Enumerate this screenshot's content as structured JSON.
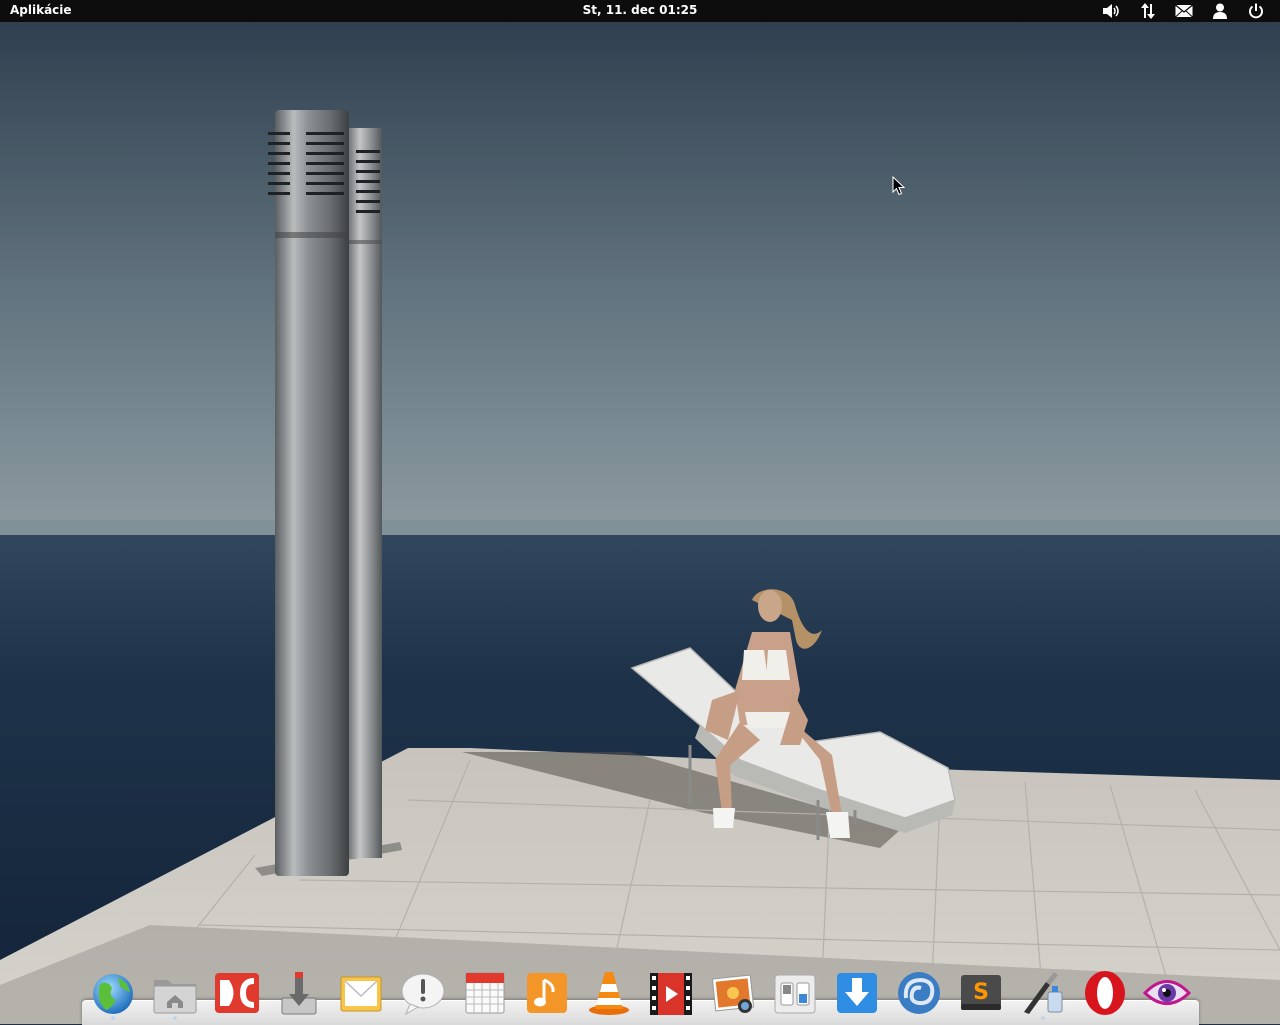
{
  "panel": {
    "applications_label": "Aplikácie",
    "clock": "St, 11. dec 01:25",
    "indicators": [
      {
        "name": "sound",
        "icon": "speaker-icon"
      },
      {
        "name": "network",
        "icon": "network-arrows-icon"
      },
      {
        "name": "messages",
        "icon": "envelope-icon"
      },
      {
        "name": "user",
        "icon": "user-icon"
      },
      {
        "name": "session",
        "icon": "power-icon"
      }
    ]
  },
  "dock": {
    "items": [
      {
        "app": "web-browser",
        "icon": "globe-icon",
        "running": true
      },
      {
        "app": "files",
        "icon": "home-folder-icon",
        "running": true
      },
      {
        "app": "double-commander",
        "icon": "dc-icon",
        "running": false
      },
      {
        "app": "software-installer",
        "icon": "install-icon",
        "running": false
      },
      {
        "app": "mail",
        "icon": "mail-icon",
        "running": false
      },
      {
        "app": "notifications",
        "icon": "exclamation-bubble-icon",
        "running": false
      },
      {
        "app": "calendar",
        "icon": "calendar-icon",
        "running": false
      },
      {
        "app": "music",
        "icon": "music-note-icon",
        "running": false
      },
      {
        "app": "vlc",
        "icon": "traffic-cone-icon",
        "running": false
      },
      {
        "app": "video",
        "icon": "film-icon",
        "running": false
      },
      {
        "app": "photos",
        "icon": "photo-icon",
        "running": false
      },
      {
        "app": "system-settings",
        "icon": "toggle-switches-icon",
        "running": false
      },
      {
        "app": "downloader",
        "icon": "download-arrow-icon",
        "running": false
      },
      {
        "app": "thunderbird",
        "icon": "swirl-icon",
        "running": false
      },
      {
        "app": "sublime-text",
        "icon": "sublime-icon",
        "running": false
      },
      {
        "app": "paint",
        "icon": "brush-icon",
        "running": true
      },
      {
        "app": "opera",
        "icon": "opera-icon",
        "running": false
      },
      {
        "app": "eye-of-gnome",
        "icon": "eye-icon",
        "running": false
      }
    ]
  },
  "colors": {
    "panel_bg": "#0d0d0d",
    "sky_top": "#2d3c4c",
    "sky_horizon": "#8a9aa0",
    "sea": "#1b2e45",
    "terrace": "#cfccc6"
  }
}
